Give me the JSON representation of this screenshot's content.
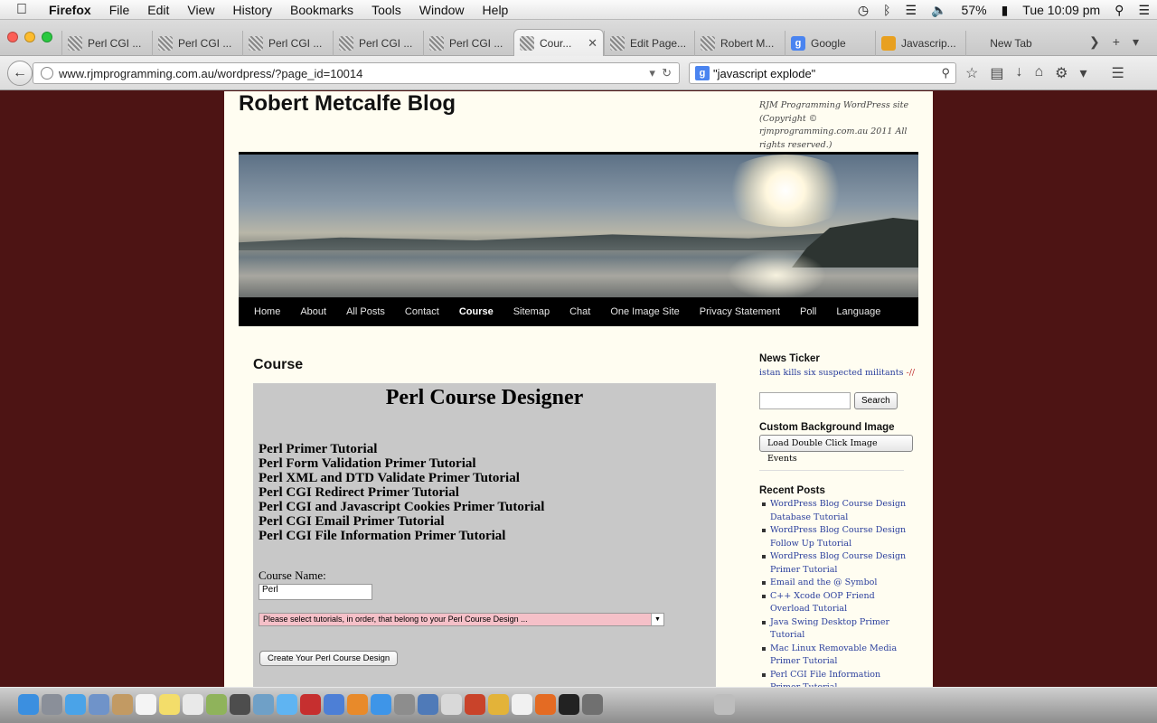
{
  "menubar": {
    "app": "Firefox",
    "items": [
      "File",
      "Edit",
      "View",
      "History",
      "Bookmarks",
      "Tools",
      "Window",
      "Help"
    ],
    "battery": "57%",
    "clock": "Tue 10:09 pm"
  },
  "tabs": [
    {
      "label": "Perl CGI ...",
      "icon": "page-icon"
    },
    {
      "label": "Perl CGI ...",
      "icon": "page-icon"
    },
    {
      "label": "Perl CGI ...",
      "icon": "page-icon"
    },
    {
      "label": "Perl CGI ...",
      "icon": "page-icon"
    },
    {
      "label": "Perl CGI ...",
      "icon": "page-icon"
    },
    {
      "label": "Cour...",
      "icon": "page-icon",
      "active": true
    },
    {
      "label": "Edit Page...",
      "icon": "page-icon"
    },
    {
      "label": "Robert M...",
      "icon": "page-icon"
    },
    {
      "label": "Google",
      "icon": "google-icon"
    },
    {
      "label": "Javascrip...",
      "icon": "js-icon"
    },
    {
      "label": "New Tab",
      "icon": "none"
    }
  ],
  "nav": {
    "url": "www.rjmprogramming.com.au/wordpress/?page_id=10014",
    "search": "\"javascript explode\""
  },
  "site": {
    "title": "Robert Metcalfe Blog",
    "description": "RJM Programming WordPress site (Copyright © rjmprogramming.com.au 2011 All rights reserved.)",
    "menu": [
      "Home",
      "About",
      "All Posts",
      "Contact",
      "Course",
      "Sitemap",
      "Chat",
      "One Image Site",
      "Privacy Statement",
      "Poll",
      "Language"
    ],
    "current_menu": "Course"
  },
  "main": {
    "heading": "Course",
    "designer_title": "Perl Course Designer",
    "tutorials": [
      "Perl Primer Tutorial",
      "Perl Form Validation Primer Tutorial",
      "Perl XML and DTD Validate Primer Tutorial",
      "Perl CGI Redirect Primer Tutorial",
      "Perl CGI and Javascript Cookies Primer Tutorial",
      "Perl CGI Email Primer Tutorial",
      "Perl CGI File Information Primer Tutorial"
    ],
    "course_name_label": "Course Name:",
    "course_name_value": "Perl",
    "select_text": "Please select tutorials, in order, that belong to your Perl Course Design ...",
    "create_button": "Create Your Perl Course Design"
  },
  "sidebar": {
    "ticker_heading": "News Ticker",
    "ticker_text": "istan kills six suspected militants",
    "ticker_sep": "-//",
    "search_button": "Search",
    "bg_heading": "Custom Background Image",
    "bg_button": "Load Double Click Image Events",
    "recent_heading": "Recent Posts",
    "recent_posts": [
      "WordPress Blog Course Design Database Tutorial",
      "WordPress Blog Course Design Follow Up Tutorial",
      "WordPress Blog Course Design Primer Tutorial",
      "Email and the @ Symbol",
      "C++ Xcode OOP Friend Overload Tutorial",
      "Java Swing Desktop Primer Tutorial",
      "Mac Linux Removable Media Primer Tutorial",
      "Perl CGI File Information Primer Tutorial"
    ]
  },
  "colors": {
    "page_bg": "#4d1414",
    "content_bg": "#fffdf1",
    "designer_bg": "#c8c8c8",
    "link": "#2a3e9c",
    "select_bg": "#f5c0c8"
  }
}
